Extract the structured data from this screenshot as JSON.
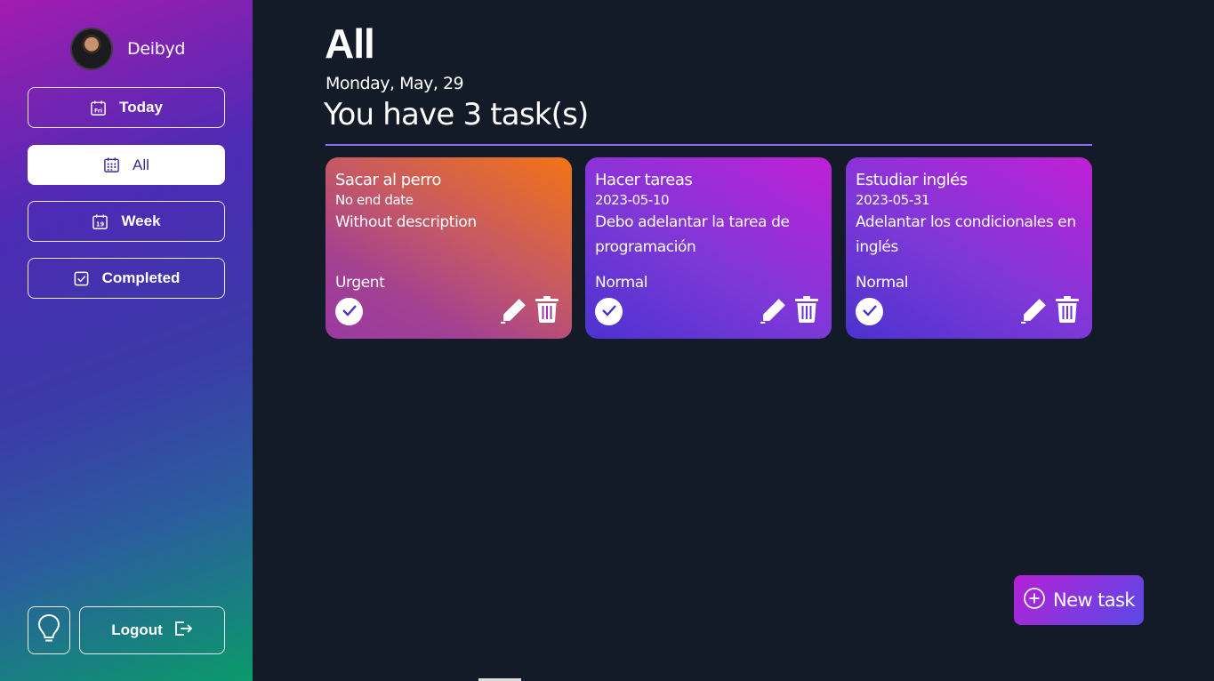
{
  "sidebar": {
    "user": {
      "name": "Deibyd",
      "avatar": "avatar-photo"
    },
    "nav": [
      {
        "label": "Today",
        "icon": "calendar-day-icon",
        "active": false
      },
      {
        "label": "All",
        "icon": "calendar-grid-icon",
        "active": true
      },
      {
        "label": "Week",
        "icon": "calendar-week-icon",
        "active": false
      },
      {
        "label": "Completed",
        "icon": "checkbox-icon",
        "active": false
      }
    ],
    "today_icon_text": "Fri",
    "week_icon_text": "19",
    "logout_label": "Logout",
    "bulb_icon": "lightbulb-icon"
  },
  "main": {
    "title": "All",
    "date": "Monday, May, 29",
    "task_count_text": "You have 3 task(s)",
    "tasks": [
      {
        "title": "Sacar al perro",
        "date": "No end date",
        "description": "Without description",
        "priority": "Urgent"
      },
      {
        "title": "Hacer tareas",
        "date": "2023-05-10",
        "description": "Debo adelantar la tarea de programación",
        "priority": "Normal"
      },
      {
        "title": "Estudiar inglés",
        "date": "2023-05-31",
        "description": "Adelantar los condicionales en inglés",
        "priority": "Normal"
      }
    ],
    "new_task_label": "New task"
  },
  "colors": {
    "background": "#131a28",
    "accent": "#9b6cf2",
    "urgent_card": "#f37414",
    "normal_card": "#7e38d8"
  }
}
